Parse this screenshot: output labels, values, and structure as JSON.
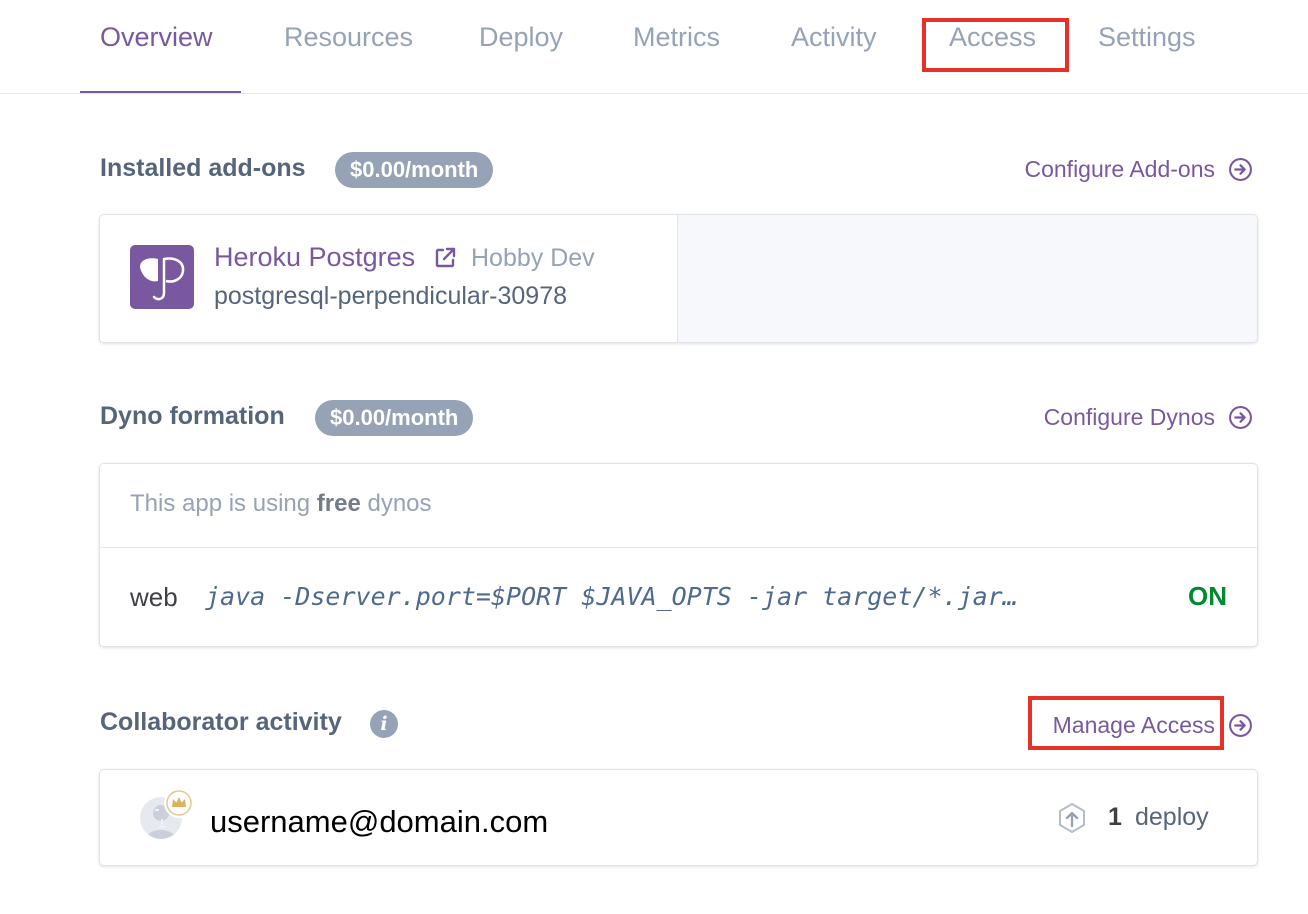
{
  "tabs": [
    {
      "label": "Overview",
      "active": true
    },
    {
      "label": "Resources"
    },
    {
      "label": "Deploy"
    },
    {
      "label": "Metrics"
    },
    {
      "label": "Activity"
    },
    {
      "label": "Access"
    },
    {
      "label": "Settings"
    }
  ],
  "addons": {
    "title": "Installed add-ons",
    "price": "$0.00/month",
    "configure_link": "Configure Add-ons",
    "item": {
      "name": "Heroku Postgres",
      "plan": "Hobby Dev",
      "id": "postgresql-perpendicular-30978",
      "logo_icon": "heroku-postgres-elephant-icon"
    }
  },
  "dynos": {
    "title": "Dyno formation",
    "price": "$0.00/month",
    "configure_link": "Configure Dynos",
    "note_prefix": "This app is using ",
    "note_bold": "free",
    "note_suffix": " dynos",
    "process": {
      "type": "web",
      "command": "java -Dserver.port=$PORT $JAVA_OPTS -jar target/*.jar…",
      "status": "ON"
    }
  },
  "collaborators": {
    "title": "Collaborator activity",
    "info_icon": "i",
    "manage_link": "Manage Access",
    "entry": {
      "email": "username@domain.com",
      "deploy_count": "1",
      "deploy_label": "deploy"
    }
  },
  "colors": {
    "accent": "#79589f",
    "muted": "#96a3b6",
    "success": "#008a2e",
    "highlight": "#e53228"
  }
}
